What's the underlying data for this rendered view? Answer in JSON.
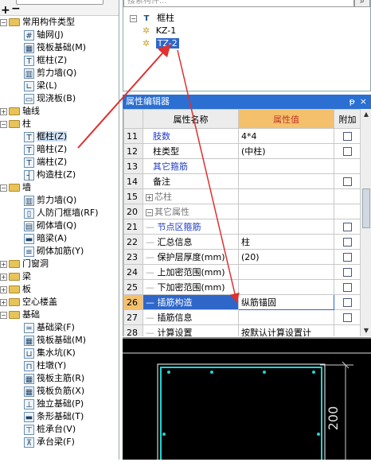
{
  "left_tree": {
    "items": [
      {
        "level": 0,
        "exp": "−",
        "type": "folder",
        "label": "常用构件类型"
      },
      {
        "level": 1,
        "icon": "grid",
        "label": "轴网(J)"
      },
      {
        "level": 1,
        "icon": "raft",
        "label": "筏板基础(M)"
      },
      {
        "level": 1,
        "icon": "column",
        "label": "框柱(Z)"
      },
      {
        "level": 1,
        "icon": "shearwall",
        "label": "剪力墙(Q)"
      },
      {
        "level": 1,
        "icon": "beam",
        "label": "梁(L)"
      },
      {
        "level": 1,
        "icon": "slab",
        "label": "现浇板(B)"
      },
      {
        "level": 0,
        "exp": "+",
        "type": "folder",
        "label": "轴线"
      },
      {
        "level": 0,
        "exp": "−",
        "type": "folder",
        "label": "柱"
      },
      {
        "level": 1,
        "icon": "column",
        "label": "框柱(Z)",
        "selected": true
      },
      {
        "level": 1,
        "icon": "hidden-column",
        "label": "暗柱(Z)"
      },
      {
        "level": 1,
        "icon": "end-column",
        "label": "端柱(Z)"
      },
      {
        "level": 1,
        "icon": "construct-column",
        "label": "构造柱(Z)"
      },
      {
        "level": 0,
        "exp": "−",
        "type": "folder",
        "label": "墙"
      },
      {
        "level": 1,
        "icon": "shearwall",
        "label": "剪力墙(Q)"
      },
      {
        "level": 1,
        "icon": "civil-wall",
        "label": "人防门框墙(RF)"
      },
      {
        "level": 1,
        "icon": "masonry",
        "label": "砌体墙(Q)"
      },
      {
        "level": 1,
        "icon": "hidden-beam",
        "label": "暗梁(A)"
      },
      {
        "level": 1,
        "icon": "masonry-rebar",
        "label": "砌体加筋(Y)"
      },
      {
        "level": 0,
        "exp": "+",
        "type": "folder",
        "label": "门窗洞"
      },
      {
        "level": 0,
        "exp": "+",
        "type": "folder",
        "label": "梁"
      },
      {
        "level": 0,
        "exp": "+",
        "type": "folder",
        "label": "板"
      },
      {
        "level": 0,
        "exp": "+",
        "type": "folder",
        "label": "空心楼盖"
      },
      {
        "level": 0,
        "exp": "−",
        "type": "folder",
        "label": "基础"
      },
      {
        "level": 1,
        "icon": "foundation-beam",
        "label": "基础梁(F)"
      },
      {
        "level": 1,
        "icon": "raft",
        "label": "筏板基础(M)"
      },
      {
        "level": 1,
        "icon": "sump",
        "label": "集水坑(K)"
      },
      {
        "level": 1,
        "icon": "pier",
        "label": "柱墩(Y)"
      },
      {
        "level": 1,
        "icon": "raft-main-rebar",
        "label": "筏板主筋(R)"
      },
      {
        "level": 1,
        "icon": "raft-neg-rebar",
        "label": "筏板负筋(X)"
      },
      {
        "level": 1,
        "icon": "isolated-footing",
        "label": "独立基础(P)"
      },
      {
        "level": 1,
        "icon": "strip-footing",
        "label": "条形基础(T)"
      },
      {
        "level": 1,
        "icon": "pile-cap",
        "label": "桩承台(V)"
      },
      {
        "level": 1,
        "icon": "cap-beam",
        "label": "承台梁(F)"
      }
    ]
  },
  "search": {
    "placeholder": "搜索构件..."
  },
  "comp_tree": {
    "root": "框柱",
    "children": [
      {
        "label": "KZ-1",
        "selected": false
      },
      {
        "label": "TZ-2",
        "selected": true
      }
    ]
  },
  "prop_panel": {
    "title": "属性编辑器",
    "pin": "ᵽ",
    "close": "×",
    "headers": {
      "name": "属性名称",
      "value": "属性值",
      "extra": "附加"
    },
    "rows": [
      {
        "n": "11",
        "name": "肢数",
        "value": "4*4",
        "cb": true,
        "blue": true
      },
      {
        "n": "12",
        "name": "柱类型",
        "value": "(中柱)",
        "cb": true
      },
      {
        "n": "13",
        "name": "其它箍筋",
        "value": "",
        "cb": false,
        "blue": true
      },
      {
        "n": "14",
        "name": "备注",
        "value": "",
        "cb": true
      },
      {
        "n": "15",
        "name": "芯柱",
        "value": "",
        "cb": false,
        "expander": "+",
        "gray": true
      },
      {
        "n": "20",
        "name": "其它属性",
        "value": "",
        "cb": false,
        "expander": "−",
        "gray": true
      },
      {
        "n": "21",
        "name": "节点区箍筋",
        "value": "",
        "cb": true,
        "blue": true,
        "tree": true
      },
      {
        "n": "22",
        "name": "汇总信息",
        "value": "柱",
        "cb": true,
        "tree": true
      },
      {
        "n": "23",
        "name": "保护层厚度(mm)",
        "value": "(20)",
        "cb": true,
        "tree": true
      },
      {
        "n": "24",
        "name": "上加密范围(mm)",
        "value": "",
        "cb": true,
        "tree": true
      },
      {
        "n": "25",
        "name": "下加密范围(mm)",
        "value": "",
        "cb": true,
        "tree": true
      },
      {
        "n": "26",
        "name": "插筋构造",
        "value": "纵筋锚固",
        "cb": true,
        "tree": true,
        "highlight": true
      },
      {
        "n": "27",
        "name": "插筋信息",
        "value": "",
        "cb": true,
        "tree": true
      },
      {
        "n": "28",
        "name": "计算设置",
        "value": "按默认计算设置计",
        "cb": false,
        "tree": true
      }
    ]
  },
  "canvas": {
    "dimension_label": "200"
  },
  "colors": {
    "accent": "#2f67c9",
    "header_value": "#f5c06b",
    "arrow": "#e03030"
  }
}
